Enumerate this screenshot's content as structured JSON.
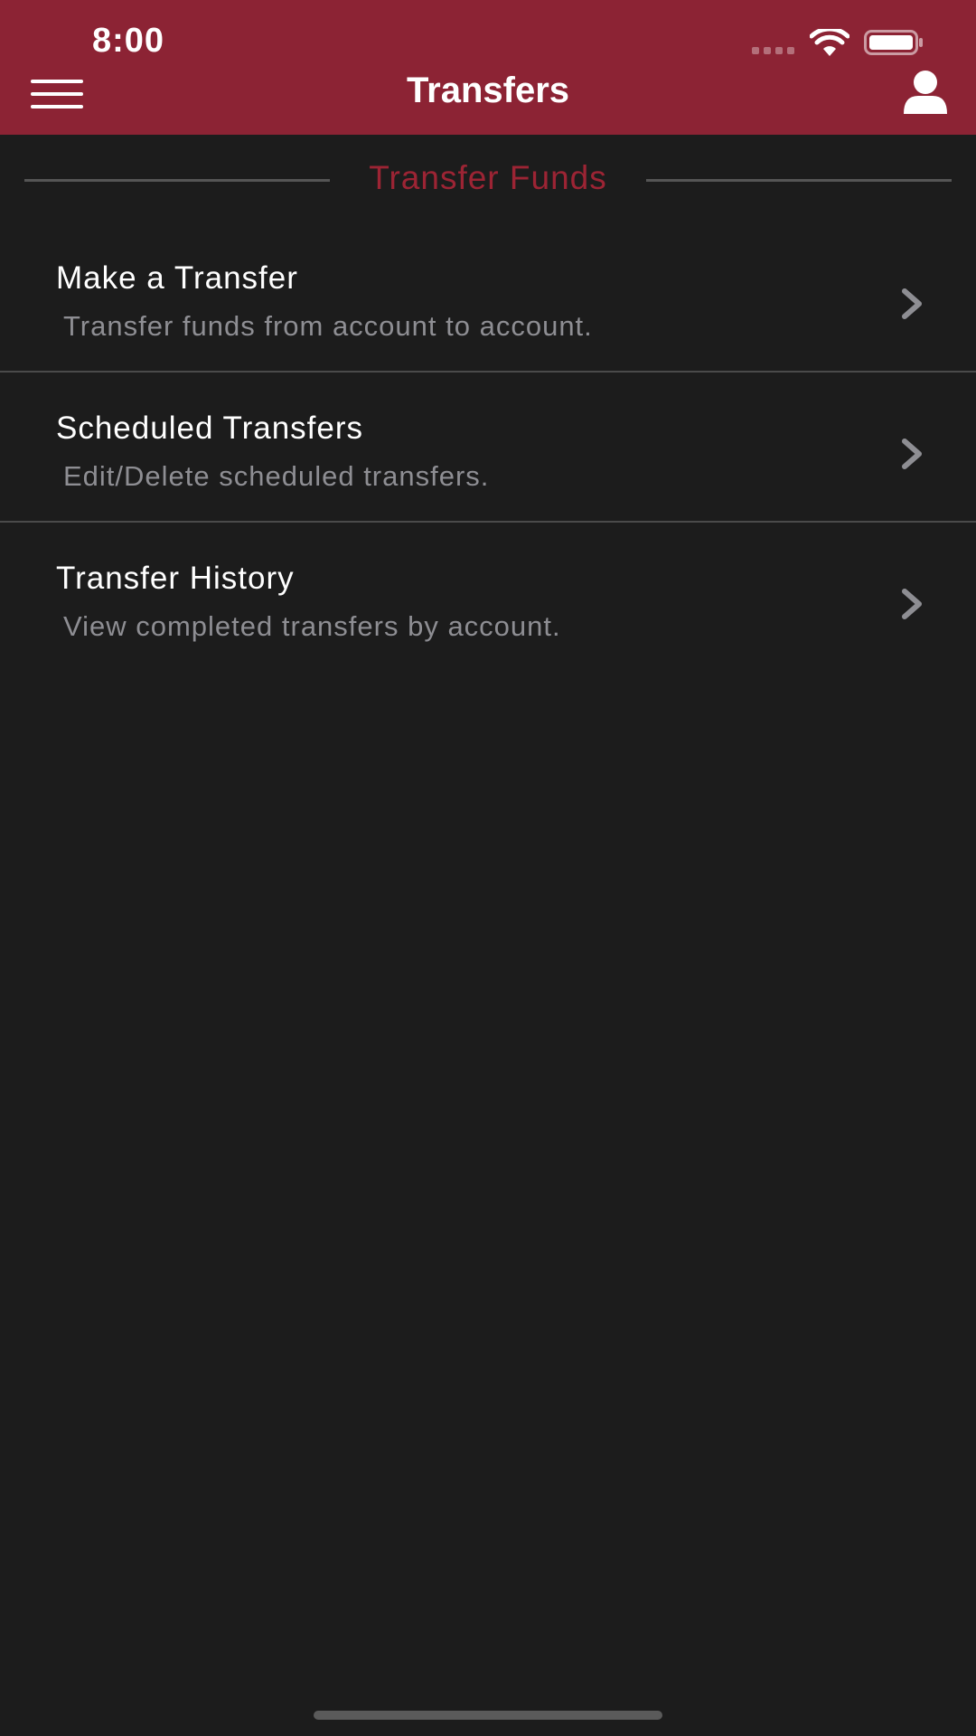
{
  "status_bar": {
    "time": "8:00"
  },
  "header": {
    "title": "Transfers",
    "background_color": "#8c2334",
    "menu_icon": "hamburger-menu-icon",
    "profile_icon": "user-profile-icon"
  },
  "section": {
    "title": "Transfer Funds",
    "title_color": "#9c2434"
  },
  "items": [
    {
      "title": "Make a Transfer",
      "subtitle": "Transfer funds from account to account.",
      "icon": "chevron-right-icon"
    },
    {
      "title": "Scheduled Transfers",
      "subtitle": "Edit/Delete scheduled transfers.",
      "icon": "chevron-right-icon"
    },
    {
      "title": "Transfer History",
      "subtitle": "View completed transfers by account.",
      "icon": "chevron-right-icon"
    }
  ]
}
